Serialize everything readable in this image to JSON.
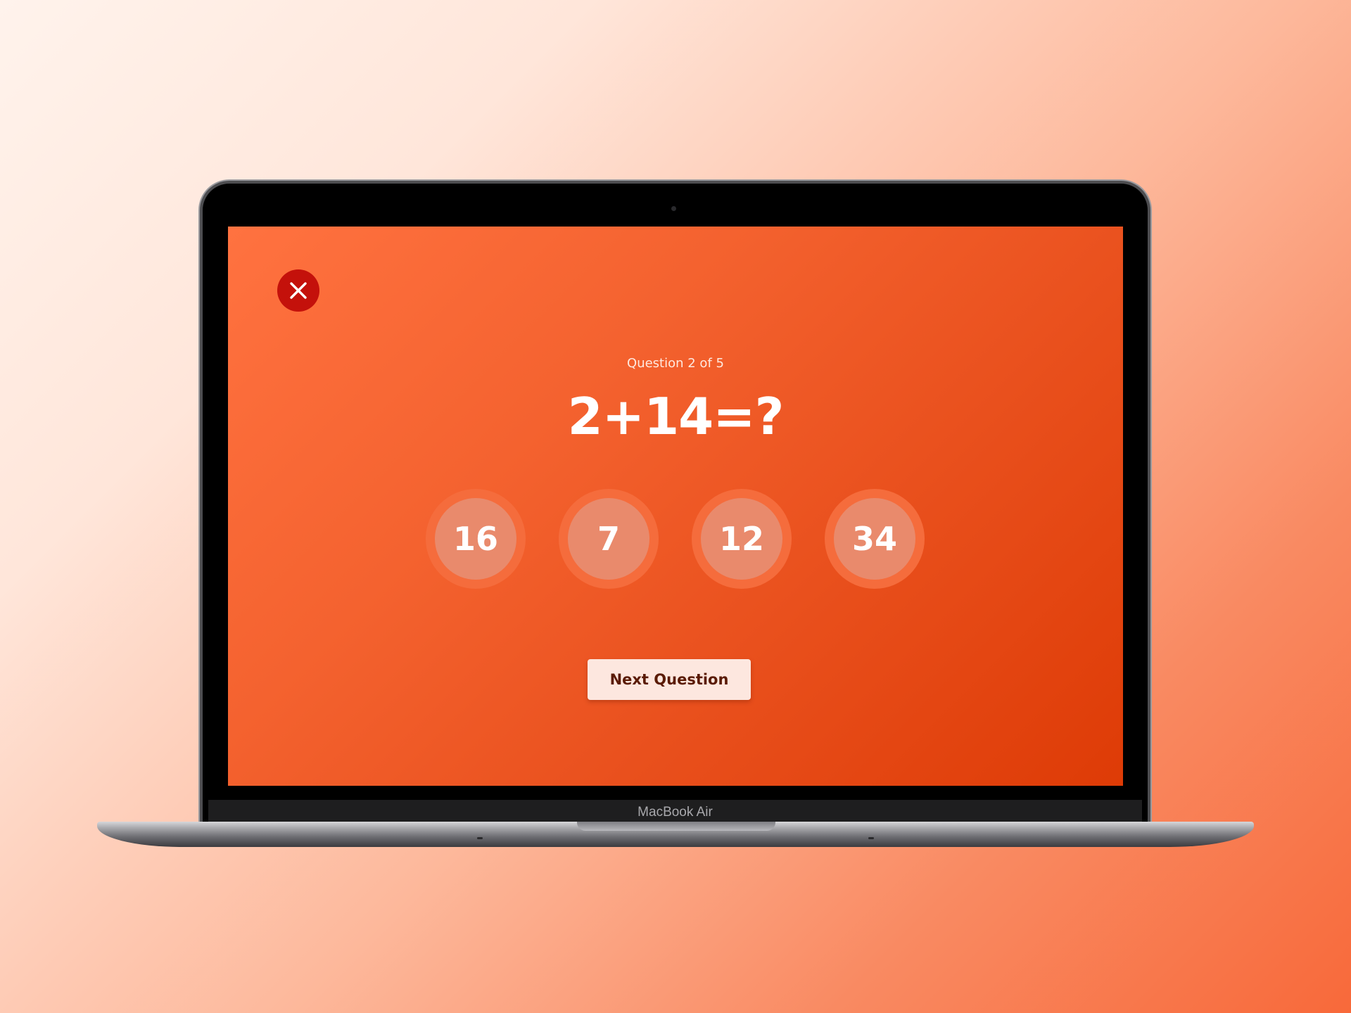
{
  "device": {
    "model_label": "MacBook Air"
  },
  "quiz": {
    "close_icon": "close-icon",
    "progress_text": "Question 2 of 5",
    "equation": "2+14=?",
    "answers": [
      {
        "label": "16"
      },
      {
        "label": "7"
      },
      {
        "label": "12"
      },
      {
        "label": "34"
      }
    ],
    "next_button_label": "Next Question"
  },
  "colors": {
    "screen_gradient_start": "#ff7240",
    "screen_gradient_end": "#de3b06",
    "close_button": "#c4110b",
    "answer_ring": "#f56c3c",
    "answer_fill": "#e98a6c",
    "next_button_bg": "#fde7df",
    "next_button_text": "#5a1b05"
  }
}
